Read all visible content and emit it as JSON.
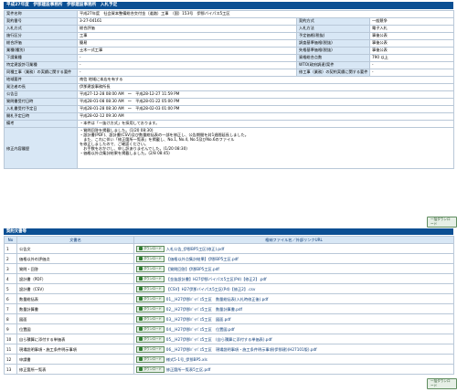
{
  "header": {
    "title": "平成27年度　伊那建設事務所　伊那建設事務所　入札予定"
  },
  "info_rows": [
    {
      "l1": "案件名称",
      "v1": "平成27年度　社会資本整備総合交付金（道路）工事　（国）153号　伊那バイパス5工区",
      "l2": "",
      "v2": "",
      "kind": "full"
    },
    {
      "l1": "契約番号",
      "v1": "3-27-04161",
      "l2": "契約方式",
      "v2": "一般競争"
    },
    {
      "l1": "入札方式",
      "v1": "総合評価",
      "l2": "入札方法",
      "v2": "電子入札"
    },
    {
      "l1": "施行区分",
      "v1": "工事",
      "l2": "予定価格(税抜)",
      "v2": "事後公表"
    },
    {
      "l1": "総合評価",
      "v1": "簡易",
      "l2": "調査基準価格(税抜)",
      "v2": "事後公表"
    },
    {
      "l1": "業種(種別)",
      "v1": "土木一式工事",
      "l2": "失格基準価格(税抜)",
      "v2": "事後公表"
    },
    {
      "l1": "下請業種",
      "v1": "-",
      "l2": "資格総合点数",
      "v2": "790 以上"
    },
    {
      "l1": "特定建設許可業種",
      "v1": "-",
      "l2": "WTO(政府調達)案件",
      "v2": "-"
    },
    {
      "l1": "同種工事（業務）の実績に関する要件",
      "v1": "-",
      "l2": "修工事（業務）の契約実績に関する要件",
      "v2": "-"
    },
    {
      "l1": "地域要件",
      "v1": "南信\n地域に本店を有する",
      "l2": "",
      "v2": "",
      "kind": "full"
    },
    {
      "l1": "発注者の長",
      "v1": "伊那建設事務所長",
      "kind": "full"
    },
    {
      "l1": "公告日",
      "v1": "平成27-12-28 08:00 AM　～　平成28-12-27 11:59 PM",
      "kind": "full"
    },
    {
      "l1": "質問書受付日時",
      "v1": "平成28-01-08 08:30 AM　～　平成28-01-22 05:00 PM",
      "kind": "full"
    },
    {
      "l1": "入札書受付予定日",
      "v1": "平成28-01-28 08:30 AM　～　平成28-02-03 01:00 PM",
      "kind": "full"
    },
    {
      "l1": "開札予定日時",
      "v1": "平成28-02-12 09:30 AM",
      "kind": "full"
    },
    {
      "l1": "備考",
      "v1": "・本件は「一抜け方式」を採用しております。",
      "kind": "full"
    }
  ],
  "correction": {
    "label": "修正内容履歴",
    "lines": [
      "・質問回答を掲載しました。(1/20 08:30)",
      "・設計書(PDF)、設計書(CSV)及び数量総括表の一部を修正し、公告期間を封1週間延長しました。",
      "　また、これに伴い「修正箇所一覧表」を掲載し、No.1, No.4, No.5及びNo.6のファイル",
      "を修正しましたので、ご確認ください。",
      "　お手数をおかけし、申し訳ありませんでした。(1/20 08:30)",
      "・価格以外点集計結果を掲載しました。(2/8 08:45)"
    ]
  },
  "download_label": "ダウンロード",
  "bulk_label": "一括ダウンロード",
  "docs": {
    "section": "契約文書等",
    "headers": {
      "no": "No",
      "name": "文書名",
      "file": "格納ファイル名／外部リンクURL"
    },
    "rows": [
      {
        "no": "1",
        "name": "公告文",
        "file": "入札公告_伊那BP5工区(修正).pdf"
      },
      {
        "no": "2",
        "name": "価格以外の評価点",
        "file": "【価格以外点集計結果】伊那BP5工区.pdf"
      },
      {
        "no": "3",
        "name": "質問・回答",
        "file": "【質問回答】伊那BP5工区.pdf"
      },
      {
        "no": "4",
        "name": "設計書（PDF）",
        "file": "【金抜設計書】H27伊那バイパス5工区(Pd)【修正2】.pdf"
      },
      {
        "no": "5",
        "name": "設計書（CSV）",
        "file": "【CSV】H27伊那バイパス5工区(Pd)【修正2】.csv"
      },
      {
        "no": "6",
        "name": "数量総括表",
        "file": "01__H27伊那ﾊﾞｲﾊﾟｽ5工区　数量総括表(入札時修正後).pdf"
      },
      {
        "no": "7",
        "name": "数量計算書",
        "file": "02__H27伊那ﾊﾞｲﾊﾟｽ5工区　数量計算書.pdf"
      },
      {
        "no": "8",
        "name": "図面",
        "file": "03__H27伊那ﾊﾞｲﾊﾟｽ5工区　図面.pdf"
      },
      {
        "no": "9",
        "name": "位置図",
        "file": "04__H27伊那ﾊﾞｲﾊﾟｽ5工区　位置図.pdf"
      },
      {
        "no": "10",
        "name": "自ら積算に添付する単価表",
        "file": "05__H27伊那ﾊﾞｲﾊﾟｽ5工区　(自ら積算に添付する単価表).pdf"
      },
      {
        "no": "11",
        "name": "現場説明事項・施工条件明示事項",
        "file": "06__H27伊那ﾊﾞｲﾊﾟｽ5工区　現場説明事項・施工条件明示事項(伊那建)(H27101版).pdf"
      },
      {
        "no": "12",
        "name": "申請書",
        "file": "様式5-1号_伊那BP5.xls"
      },
      {
        "no": "13",
        "name": "修正箇所一覧表",
        "file": "修正箇所一覧表5工区.pdf"
      }
    ]
  }
}
